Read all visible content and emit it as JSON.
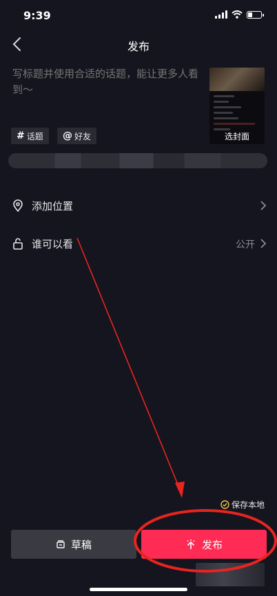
{
  "status_bar": {
    "time": "9:39"
  },
  "header": {
    "title": "发布",
    "back_icon": "chevron-left-icon"
  },
  "caption": {
    "placeholder": "写标题并使用合适的话题，能让更多人看到～"
  },
  "cover": {
    "label": "选封面"
  },
  "tags": [
    {
      "symbol": "#",
      "label": "话题"
    },
    {
      "symbol": "@",
      "label": "好友"
    }
  ],
  "menu": {
    "location": {
      "label": "添加位置",
      "icon": "location-pin-icon"
    },
    "visibility": {
      "label": "谁可以看",
      "value": "公开",
      "icon": "lock-icon"
    }
  },
  "save_local": {
    "label": "保存本地",
    "checked": true
  },
  "buttons": {
    "draft": {
      "label": "草稿",
      "icon": "draft-box-icon"
    },
    "publish": {
      "label": "发布",
      "icon": "publish-sparkle-icon"
    }
  },
  "colors": {
    "background": "#15151f",
    "publish_button": "#fe2c55",
    "draft_button": "#393a42",
    "annotation": "#e8241f",
    "save_local_check": "#f5c242"
  }
}
